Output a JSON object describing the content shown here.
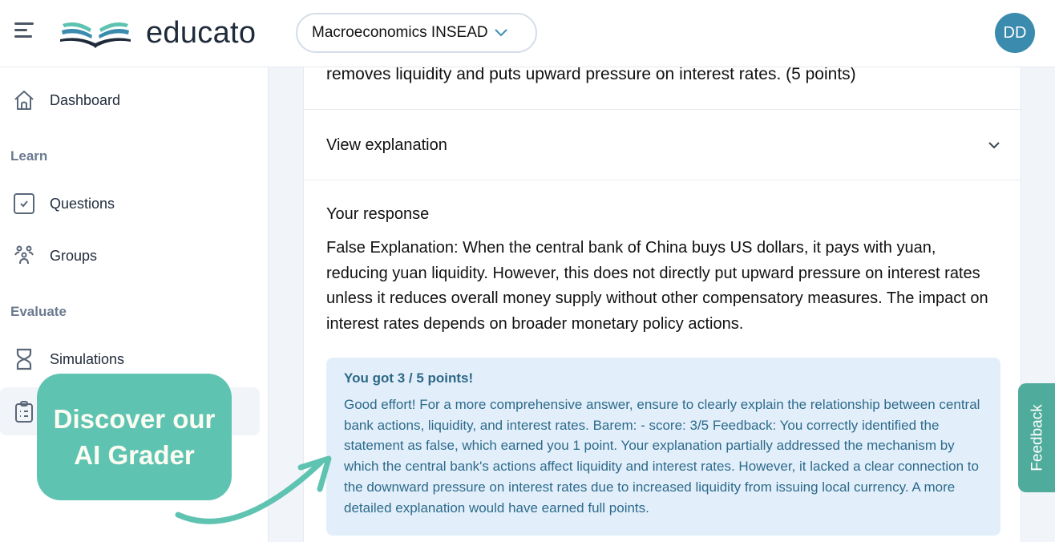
{
  "header": {
    "brand": "educato",
    "course_selector": {
      "value": "Macroeconomics INSEAD"
    },
    "avatar_initials": "DD"
  },
  "sidebar": {
    "items": [
      {
        "label": "Dashboard",
        "icon": "home-icon"
      },
      {
        "section": "Learn"
      },
      {
        "label": "Questions",
        "icon": "checkbox-icon"
      },
      {
        "label": "Groups",
        "icon": "users-group-icon"
      },
      {
        "section": "Evaluate"
      },
      {
        "label": "Simulations",
        "icon": "hourglass-icon"
      },
      {
        "label": "",
        "icon": "clipboard-icon",
        "active": true
      }
    ]
  },
  "main": {
    "question_tail": "removes liquidity and puts upward pressure on interest rates. (5 points)",
    "view_explanation_label": "View explanation",
    "response_title": "Your response",
    "response_text": "False Explanation: When the central bank of China buys US dollars, it pays with yuan, reducing yuan liquidity. However, this does not directly put upward pressure on interest rates unless it reduces overall money supply without other compensatory measures. The impact on interest rates depends on broader monetary policy actions.",
    "feedback": {
      "title": "You got 3 / 5 points!",
      "score": 3,
      "max_score": 5,
      "text": "Good effort! For a more comprehensive answer, ensure to clearly explain the relationship between central bank actions, liquidity, and interest rates. Barem: - score: 3/5 Feedback: You correctly identified the statement as false, which earned you 1 point. Your explanation partially addressed the mechanism by which the central bank's actions affect liquidity and interest rates. However, it lacked a clear connection to the downward pressure on interest rates due to increased liquidity from issuing local currency. A more detailed explanation would have earned full points."
    }
  },
  "feedback_tab_label": "Feedback",
  "promo": {
    "line1": "Discover our",
    "line2": "AI Grader"
  },
  "colors": {
    "brand_teal": "#5fc3b2",
    "avatar_blue": "#3b8bae",
    "feedback_bg": "#e2effb",
    "feedback_text": "#2d6a8a",
    "feedback_tab": "#4fab9b"
  }
}
